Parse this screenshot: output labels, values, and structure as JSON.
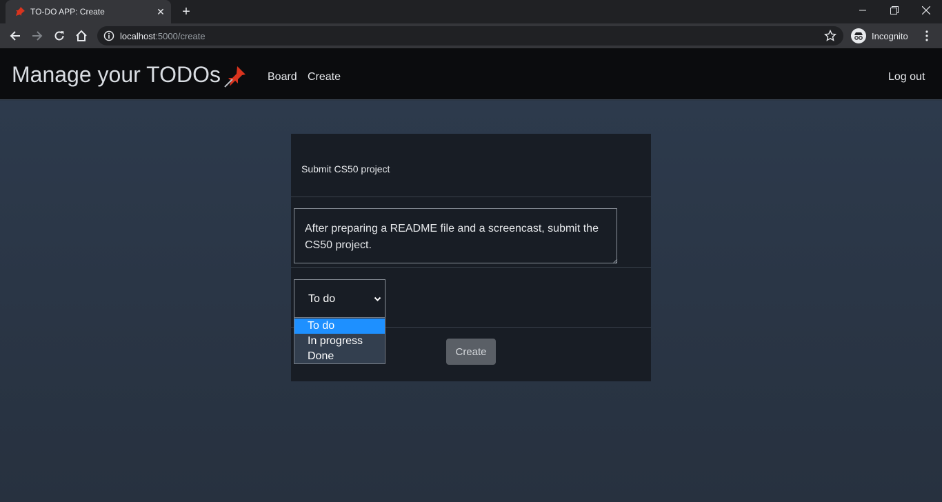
{
  "browser": {
    "tab_title": "TO-DO APP: Create",
    "url_host": "localhost",
    "url_path": ":5000/create",
    "profile_label": "Incognito"
  },
  "icons": {
    "favicon": "pushpin-icon",
    "brand": "pushpin-icon"
  },
  "colors": {
    "navbar": "#0b0c0e",
    "page_background": "#2a3646",
    "card": "#181d25",
    "selected_option": "#1e90ff",
    "pin": "#d9341e"
  },
  "navbar": {
    "brand": "Manage your TODOs",
    "links": [
      "Board",
      "Create"
    ],
    "logout": "Log out"
  },
  "form": {
    "title": "Submit CS50 project",
    "description": "After preparing a README file and a screencast, submit the CS50 project.",
    "status_value": "To do",
    "status_options": [
      "To do",
      "In progress",
      "Done"
    ],
    "submit_label": "Create"
  }
}
